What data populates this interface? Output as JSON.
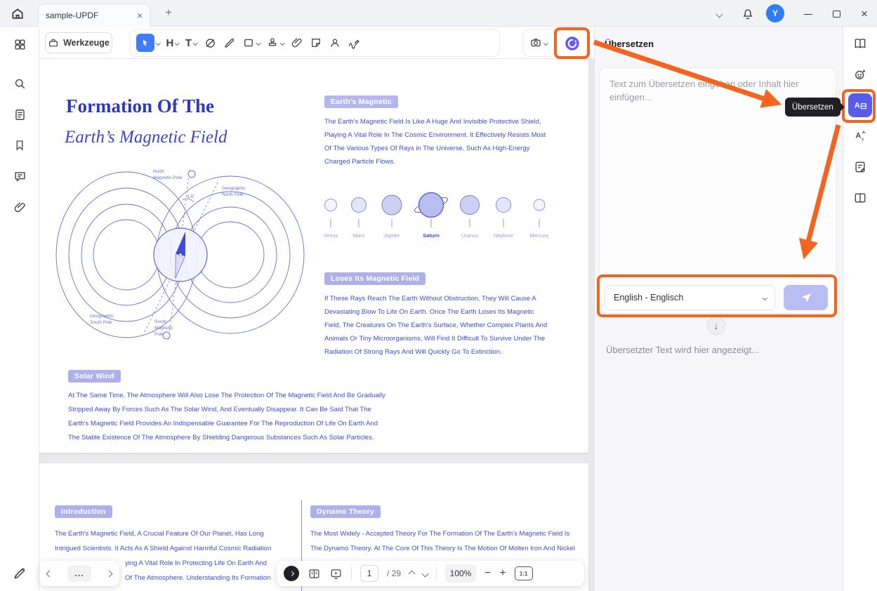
{
  "colors": {
    "annotation_orange": "#F5641E",
    "doc_text_blue": "#3D4BD0",
    "chip_purple": "#AEB1E9",
    "select_tool_blue": "#3E7DF6",
    "translate_tile_blue": "#585CE8",
    "avatar_blue": "#2E7CF6",
    "send_button_purple": "#BABDF3"
  },
  "titlebar": {
    "tab_title": "sample-UPDF",
    "avatar_initial": "Y"
  },
  "toolbar": {
    "werkzeuge_label": "Werkzeuge"
  },
  "icons": {
    "close": "×",
    "plus": "+",
    "minus": "−",
    "down_arrow": "↓",
    "more": "...",
    "tool_h": "H",
    "tool_t": "T",
    "letter_a": "A",
    "letter_x": "x"
  },
  "left_rail": [
    "apps-grid",
    "search",
    "page-thumbnails",
    "bookmarks",
    "comments",
    "attachments",
    "signature-pen"
  ],
  "right_rail": [
    "reader-annotation",
    "ai-assistant",
    "translate",
    "word-translate",
    "form-fill",
    "page-layout"
  ],
  "translate_panel": {
    "title": "Übersetzen",
    "input_placeholder": "Text zum Übersetzen eingeben oder Inhalt hier einfügen...",
    "language_selected": "English - Englisch",
    "output_placeholder": "Übersetzter Text wird hier angezeigt...",
    "tooltip": "Übersetzen"
  },
  "statusbar": {
    "page_value": "1",
    "page_total": "/ 29",
    "zoom_value": "100%",
    "fit_label": "1:1"
  },
  "document": {
    "page1": {
      "title_line1": "Formation Of The",
      "title_line2": "Earth’s Magnetic Field",
      "chip_earth": "Earth's Magnetic",
      "chip_loses": "Loses Its Magnetic Field",
      "chip_solar": "Solar Wind",
      "earth_para": {
        "lines": [
          "The Earth's Magnetic Field Is Like A Huge And Invisible Protective Shield,",
          "Playing A Vital Role In The Cosmic Environment. It Effectively Resists Most",
          "Of The Various Types Of Rays in The Universe, Such As High-Energy",
          "Charged Particle Flows."
        ]
      },
      "loses_para": {
        "lines": [
          "If These Rays Reach The Earth Without Obstruction, They Will Cause A",
          "Devastating Blow To Life On Earth. Once The Earth Loses Its Magnetic",
          "Field, The Creatures On The Earth's Surface, Whether Complex Plants And",
          "Animals Or Tiny Microorganisms, Will Find It Difficult To Survive Under The",
          "Radiation Of Strong Rays And Will Quickly Go To Extinction."
        ]
      },
      "solar_para": {
        "lines": [
          "At The Same Time, The Atmosphere Will Also Lose The Protection Of The Magnetic Field And Be Gradually",
          "Stripped Away By Forces Such As The Solar Wind, And Eventually Disappear. It Can Be Said That The",
          "Earth's Magnetic Field Provides An Indispensable Guarantee For The Reproduction Of Life On Earth And",
          "The Stable Existence Of The Atmosphere By Shielding Dangerous Substances Such As Solar Particles."
        ]
      },
      "planets": [
        "Venus",
        "Mars",
        "Jupiter",
        "Saturn",
        "Uranus",
        "Neptune",
        "Mercury"
      ],
      "diagram": {
        "north_1": "North",
        "north_2": "Magnetic Pole",
        "geo_north_1": "Geographic",
        "geo_north_2": "North Pole",
        "geo_south_1": "Geographic",
        "geo_south_2": "South Pole",
        "south_1": "South",
        "south_2": "Magnetic",
        "south_3": "Pole",
        "angle": "3.5°"
      }
    },
    "page2": {
      "chip_intro": "Introduction",
      "chip_dynamo": "Dynamo Theory",
      "intro_para": {
        "lines": [
          "The Earth's Magnetic Field, A Crucial Feature Of Our Planet, Has Long",
          "Intrigued Scientists. It Acts As A Shield Against Harmful Cosmic Radiation",
          "ying A Vital Role In Protecting Life On Earth And",
          "Of The Atmosphere. Understanding Its Formation"
        ]
      },
      "dynamo_para": {
        "lines": [
          "The Most Widely - Accepted Theory For The Formation Of The Earth's Magnetic Field Is",
          "The Dynamo Theory. At The Core Of This Theory Is The Motion Of Molten Iron And Nickel"
        ]
      }
    }
  }
}
